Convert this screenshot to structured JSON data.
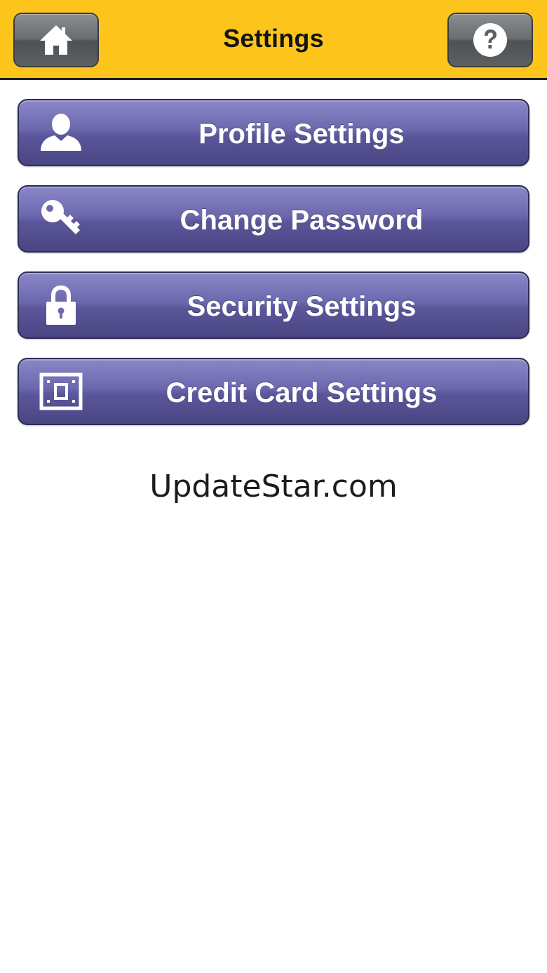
{
  "header": {
    "title": "Settings",
    "home_icon": "home-icon",
    "help_icon": "help-icon"
  },
  "menu": [
    {
      "label": "Profile Settings",
      "icon": "user-icon"
    },
    {
      "label": "Change Password",
      "icon": "key-icon"
    },
    {
      "label": "Security Settings",
      "icon": "lock-icon"
    },
    {
      "label": "Credit Card Settings",
      "icon": "credit-card-icon"
    }
  ],
  "footer": {
    "text": "UpdateStar.com"
  },
  "colors": {
    "header_bg": "#fdc51c",
    "button_purple": "#6c68ae",
    "header_button_gray": "#6a6d70"
  }
}
